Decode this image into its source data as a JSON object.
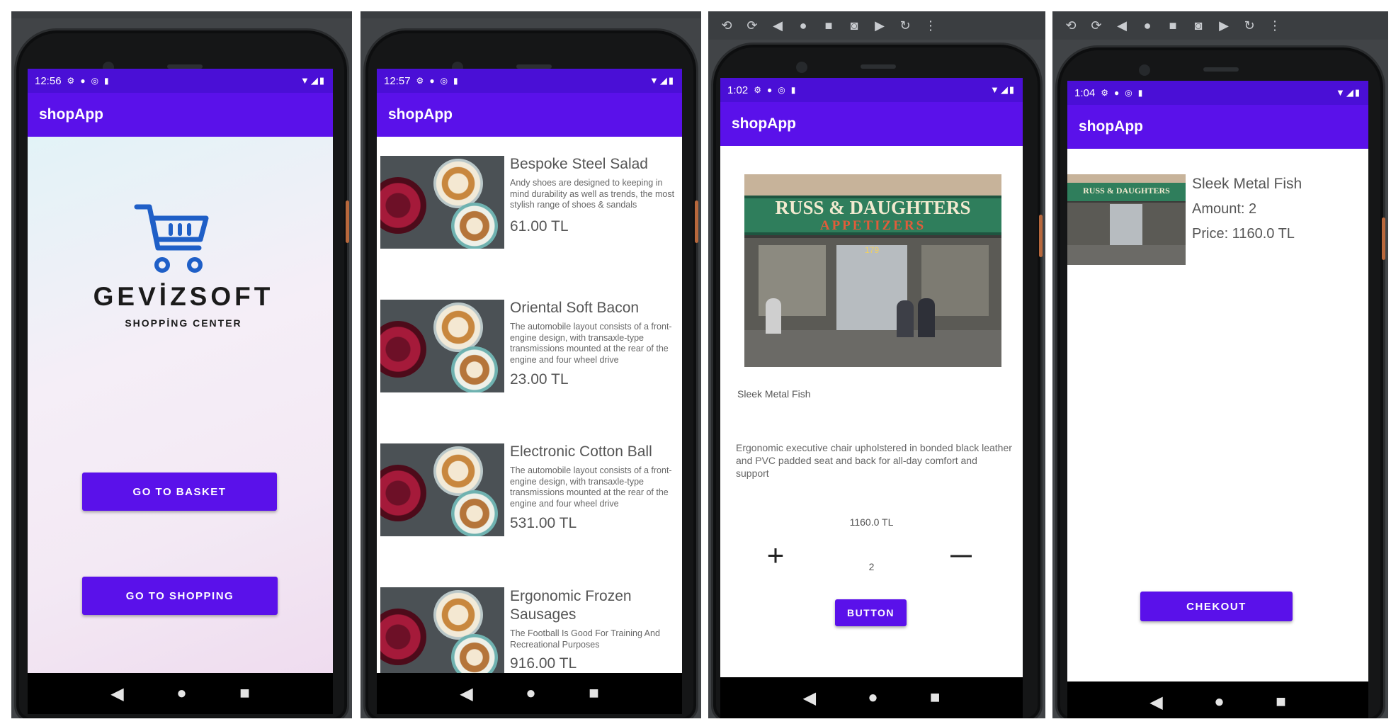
{
  "toolbar_icons": [
    "rotate-left-icon",
    "rotate-right-icon",
    "back-icon",
    "home-icon",
    "overview-icon",
    "camera-icon",
    "video-icon",
    "replay-icon",
    "more-icon"
  ],
  "app": {
    "title": "shopApp"
  },
  "screens": [
    {
      "time": "12:56",
      "logo": {
        "brand": "GEVİZSOFT",
        "tagline": "SHOPPİNG CENTER"
      },
      "buttons": {
        "basket": "GO TO BASKET",
        "shopping": "GO TO SHOPPING"
      }
    },
    {
      "time": "12:57",
      "products": [
        {
          "title": "Bespoke Steel Salad",
          "desc": "Andy shoes are designed to keeping in mind durability as well as trends, the most stylish range of shoes & sandals",
          "price": "61.00 TL"
        },
        {
          "title": "Oriental Soft Bacon",
          "desc": "The automobile layout consists of a front-engine design, with transaxle-type transmissions mounted at the rear of the engine and four wheel drive",
          "price": "23.00 TL"
        },
        {
          "title": "Electronic Cotton Ball",
          "desc": "The automobile layout consists of a front-engine design, with transaxle-type transmissions mounted at the rear of the engine and four wheel drive",
          "price": "531.00 TL"
        },
        {
          "title": "Ergonomic Frozen Sausages",
          "desc": "The Football Is Good For Training And Recreational Purposes",
          "price": "916.00 TL"
        }
      ]
    },
    {
      "time": "1:02",
      "product_name": "Sleek Metal Fish",
      "description": "Ergonomic executive chair upholstered in bonded black leather and PVC padded seat and back for all-day comfort and support",
      "price": "1160.0 TL",
      "quantity": "2",
      "plus": "+",
      "minus": "—",
      "button": "BUTTON",
      "store_sign": {
        "line1": "RUSS & DAUGHTERS",
        "line2": "APPETIZERS",
        "number": "179"
      }
    },
    {
      "time": "1:04",
      "name": "Sleek Metal Fish",
      "amount": "Amount: 2",
      "price": "Price: 1160.0 TL",
      "checkout": "CHEKOUT",
      "store_sign": "RUSS & DAUGHTERS"
    }
  ],
  "nav": {
    "back": "◀",
    "home": "●",
    "recents": "■"
  }
}
